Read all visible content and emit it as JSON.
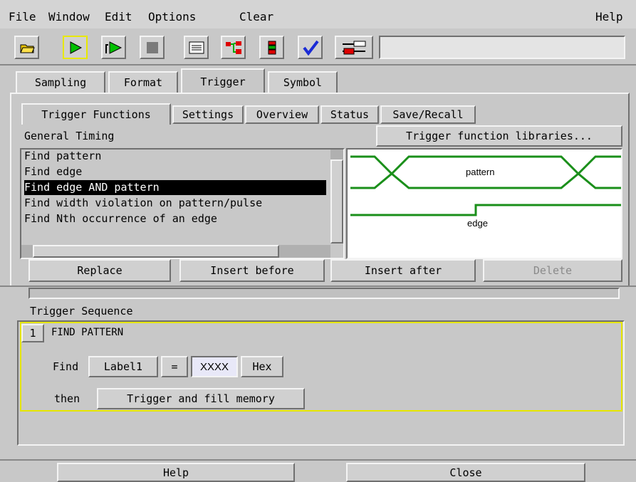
{
  "menu": {
    "file": "File",
    "window": "Window",
    "edit": "Edit",
    "options": "Options",
    "clear": "Clear",
    "help": "Help"
  },
  "toolbar": {
    "icons": [
      "open-folder-icon",
      "run-icon",
      "run-repetitive-icon",
      "stop-icon",
      "listing-icon",
      "waveform-icon",
      "chart-icon",
      "checkmark-icon",
      "setup-icon"
    ],
    "status_value": ""
  },
  "tabs": [
    "Sampling",
    "Format",
    "Trigger",
    "Symbol"
  ],
  "active_tab": "Trigger",
  "subtabs": [
    "Trigger Functions",
    "Settings",
    "Overview",
    "Status",
    "Save/Recall"
  ],
  "active_subtab": "Trigger Functions",
  "function_group": "General Timing",
  "libraries_button": "Trigger function libraries...",
  "functions": [
    "Find pattern",
    "Find edge",
    "Find edge AND pattern",
    "Find width violation on pattern/pulse",
    "Find Nth occurrence of an edge"
  ],
  "selected_function_index": 2,
  "preview": {
    "pattern_label": "pattern",
    "edge_label": "edge",
    "wave_color": "#1a8f1a"
  },
  "actions": {
    "replace": "Replace",
    "insert_before": "Insert before",
    "insert_after": "Insert after",
    "delete": "Delete"
  },
  "sequence": {
    "title": "Trigger Sequence",
    "step_number": "1",
    "step_name": "FIND PATTERN",
    "find_label": "Find",
    "label_button": "Label1",
    "operator": "=",
    "value": "XXXX",
    "base": "Hex",
    "then_label": "then",
    "action_button": "Trigger and fill memory"
  },
  "footer": {
    "help": "Help",
    "close": "Close"
  }
}
